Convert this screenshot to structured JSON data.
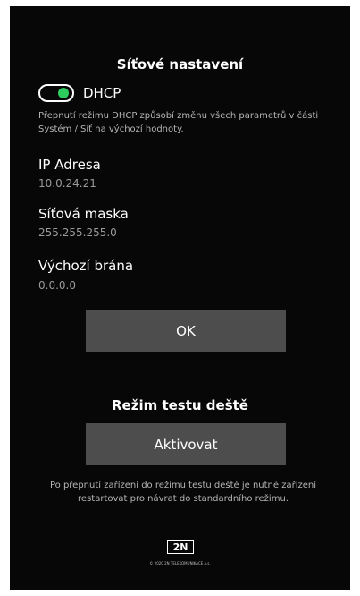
{
  "network": {
    "title": "Síťové nastavení",
    "dhcp_label": "DHCP",
    "dhcp_enabled": true,
    "dhcp_note": "Přepnutí režimu DHCP způsobí změnu všech parametrů v části Systém / Síť na výchozí hodnoty.",
    "ip_label": "IP Adresa",
    "ip_value": "10.0.24.21",
    "mask_label": "Síťová maska",
    "mask_value": "255.255.255.0",
    "gateway_label": "Výchozí brána",
    "gateway_value": "0.0.0.0",
    "ok_label": "OK"
  },
  "rain_test": {
    "title": "Režim testu deště",
    "activate_label": "Aktivovat",
    "note": "Po přepnutí zařízení do režimu testu deště je nutné zařízení restartovat pro návrat do standardního režimu."
  },
  "footer": {
    "logo_text": "2N",
    "copyright": "© 2020 2N TELEKOMUNIKACE a.s."
  },
  "colors": {
    "background": "#070707",
    "toggle_on": "#2ecc5f",
    "button": "#4d4d4d"
  }
}
